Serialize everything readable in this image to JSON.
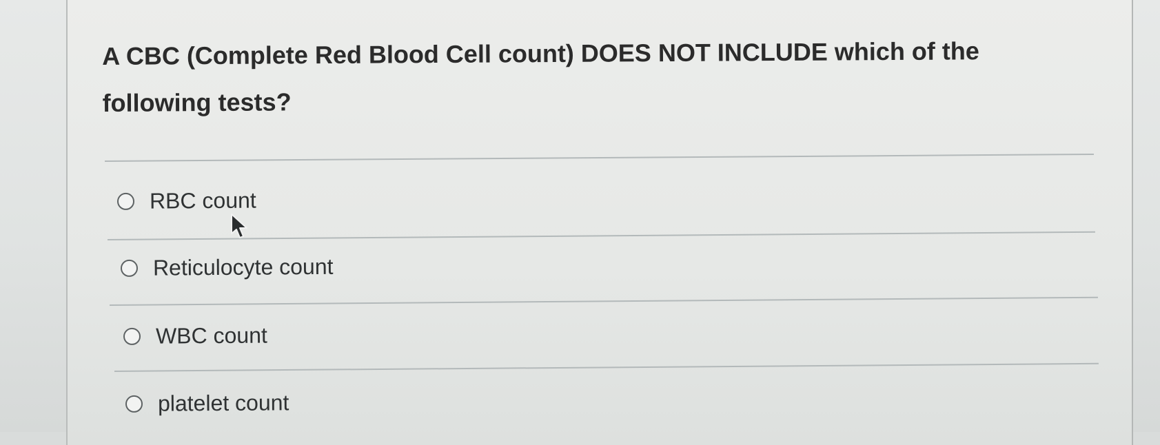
{
  "question": {
    "text": "A CBC (Complete Red Blood Cell count) DOES NOT INCLUDE which of the following tests?"
  },
  "choices": [
    {
      "label": "RBC count",
      "selected": false
    },
    {
      "label": "Reticulocyte count",
      "selected": false
    },
    {
      "label": "WBC count",
      "selected": false
    },
    {
      "label": "platelet count",
      "selected": false
    }
  ],
  "cursor_icon": "arrow-pointer-icon"
}
